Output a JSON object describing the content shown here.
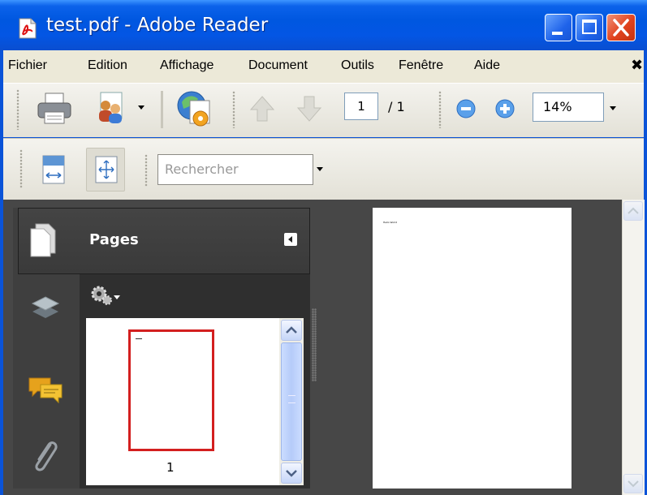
{
  "window": {
    "title": "test.pdf - Adobe Reader",
    "close_doc_symbol": "✖"
  },
  "menu": {
    "items": [
      "Fichier",
      "Edition",
      "Affichage",
      "Document",
      "Outils",
      "Fenêtre",
      "Aide"
    ]
  },
  "toolbar": {
    "page_current": "1",
    "page_total": "/ 1",
    "zoom_value": "14%",
    "search_placeholder": "Rechercher"
  },
  "nav_panel": {
    "title": "Pages",
    "thumbnail_label": "1"
  },
  "document": {
    "text": "Hello World"
  },
  "colors": {
    "titlebar": "#0356e4",
    "panel_dark": "#2f2f2f",
    "selection_red": "#d31f1f"
  }
}
